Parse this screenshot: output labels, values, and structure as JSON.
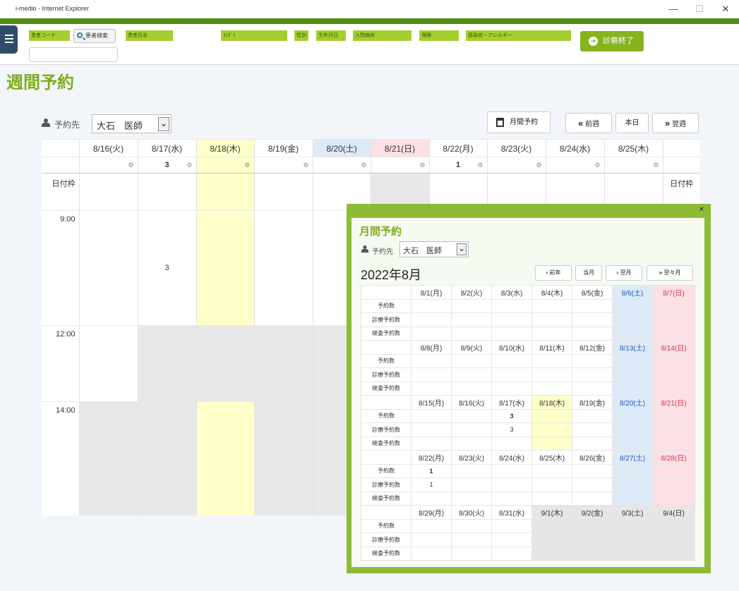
{
  "window": {
    "title": "i-medio - Internet Explorer",
    "min": "—",
    "max": "☐",
    "close": "✕"
  },
  "header": {
    "labels": [
      "患者コード",
      "患者氏名",
      "ﾖﾐｶﾞﾅ",
      "性別",
      "生年月日",
      "入院病床",
      "保険",
      "感染症・アレルギー"
    ],
    "search_button": "患者検索",
    "end_button": "診察終了"
  },
  "page_title": "週間予約",
  "week": {
    "resource_label": "予約先",
    "resource_value": "大石　医師",
    "dropdown": "⌄",
    "month_button": "月間予約",
    "prev_button": "前週",
    "today_button": "本日",
    "next_button": "翌週",
    "days": [
      "8/16(火)",
      "8/17(水)",
      "8/18(木)",
      "8/19(金)",
      "8/20(土)",
      "8/21(日)",
      "8/22(月)",
      "8/23(火)",
      "8/24(水)",
      "8/25(木)"
    ],
    "counts": [
      "",
      "3",
      "",
      "",
      "",
      "",
      "1",
      "",
      "",
      ""
    ],
    "row_label_top": "日付枠",
    "row_label_right": "日付枠",
    "times": [
      "9:00",
      "12:00",
      "14:00"
    ],
    "slot_count_817": "3",
    "gear": "⚙"
  },
  "monthly": {
    "title": "月間予約",
    "close": "✕",
    "resource_label": "予約先",
    "resource_value": "大石　医師",
    "dropdown": "⌄",
    "year_month": "2022年8月",
    "prev_year": "前年",
    "current_month": "当月",
    "next_month": "翌月",
    "next_next_month": "翌々月",
    "row_labels": [
      "予約数",
      "診療予約数",
      "検査予約数"
    ],
    "weeks": [
      {
        "dates": [
          "8/1(月)",
          "8/2(火)",
          "8/3(水)",
          "8/4(木)",
          "8/5(金)",
          "8/6(土)",
          "8/7(日)"
        ],
        "res": [
          "",
          "",
          "",
          "",
          "",
          "",
          ""
        ],
        "med": [
          "",
          "",
          "",
          "",
          "",
          "",
          ""
        ],
        "exam": [
          "",
          "",
          "",
          "",
          "",
          "",
          ""
        ]
      },
      {
        "dates": [
          "8/8(月)",
          "8/9(火)",
          "8/10(水)",
          "8/11(木)",
          "8/12(金)",
          "8/13(土)",
          "8/14(日)"
        ],
        "res": [
          "",
          "",
          "",
          "",
          "",
          "",
          ""
        ],
        "med": [
          "",
          "",
          "",
          "",
          "",
          "",
          ""
        ],
        "exam": [
          "",
          "",
          "",
          "",
          "",
          "",
          ""
        ]
      },
      {
        "dates": [
          "8/15(月)",
          "8/16(火)",
          "8/17(水)",
          "8/18(木)",
          "8/19(金)",
          "8/20(土)",
          "8/21(日)"
        ],
        "res": [
          "",
          "",
          "3",
          "",
          "",
          "",
          ""
        ],
        "med": [
          "",
          "",
          "3",
          "",
          "",
          "",
          ""
        ],
        "exam": [
          "",
          "",
          "",
          "",
          "",
          "",
          ""
        ]
      },
      {
        "dates": [
          "8/22(月)",
          "8/23(火)",
          "8/24(水)",
          "8/25(木)",
          "8/26(金)",
          "8/27(土)",
          "8/28(日)"
        ],
        "res": [
          "1",
          "",
          "",
          "",
          "",
          "",
          ""
        ],
        "med": [
          "1",
          "",
          "",
          "",
          "",
          "",
          ""
        ],
        "exam": [
          "",
          "",
          "",
          "",
          "",
          "",
          ""
        ]
      },
      {
        "dates": [
          "8/29(月)",
          "8/30(火)",
          "8/31(水)",
          "9/1(木)",
          "9/2(金)",
          "9/3(土)",
          "9/4(日)"
        ],
        "res": [
          "",
          "",
          "",
          "",
          "",
          "",
          ""
        ],
        "med": [
          "",
          "",
          "",
          "",
          "",
          "",
          ""
        ],
        "exam": [
          "",
          "",
          "",
          "",
          "",
          "",
          ""
        ]
      }
    ]
  }
}
